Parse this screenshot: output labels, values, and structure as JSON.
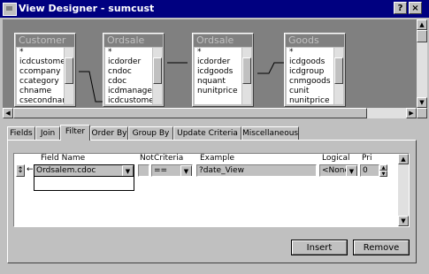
{
  "window": {
    "title": "View Designer - sumcust"
  },
  "titlebar_buttons": {
    "help": "?",
    "close": "×"
  },
  "tables": [
    {
      "name": "Customer",
      "fields": [
        "*",
        "icdcustomer",
        "ccompany",
        "ccategory",
        "chname",
        "csecondname"
      ]
    },
    {
      "name": "Ordsale",
      "fields": [
        "*",
        "icdorder",
        "cndoc",
        "cdoc",
        "icdmanager",
        "icdcustomer"
      ]
    },
    {
      "name": "Ordsale",
      "fields": [
        "*",
        "icdorder",
        "icdgoods",
        "nquant",
        "nunitprice"
      ]
    },
    {
      "name": "Goods",
      "fields": [
        "*",
        "icdgoods",
        "icdgroup",
        "cnmgoods",
        "cunit",
        "nunitprice"
      ]
    }
  ],
  "tabs": [
    {
      "label": "Fields",
      "active": false
    },
    {
      "label": "Join",
      "active": false
    },
    {
      "label": "Filter",
      "active": true
    },
    {
      "label": "Order By",
      "active": false
    },
    {
      "label": "Group By",
      "active": false
    },
    {
      "label": "Update Criteria",
      "active": false
    },
    {
      "label": "Miscellaneous",
      "active": false
    }
  ],
  "filter": {
    "headers": {
      "field_name": "Field Name",
      "not": "Not",
      "criteria": "Criteria",
      "example": "Example",
      "logical": "Logical",
      "pri": "Pri"
    },
    "row": {
      "arrows": "↕",
      "field_name": "Ordsalem.cdoc",
      "criteria": "==",
      "example": "?date_View",
      "logical": "<None>",
      "pri": "0"
    }
  },
  "buttons": {
    "insert": "Insert",
    "remove": "Remove"
  },
  "colors": {
    "titlebar": "#000080",
    "face": "#c0c0c0",
    "workspace": "#808080"
  }
}
